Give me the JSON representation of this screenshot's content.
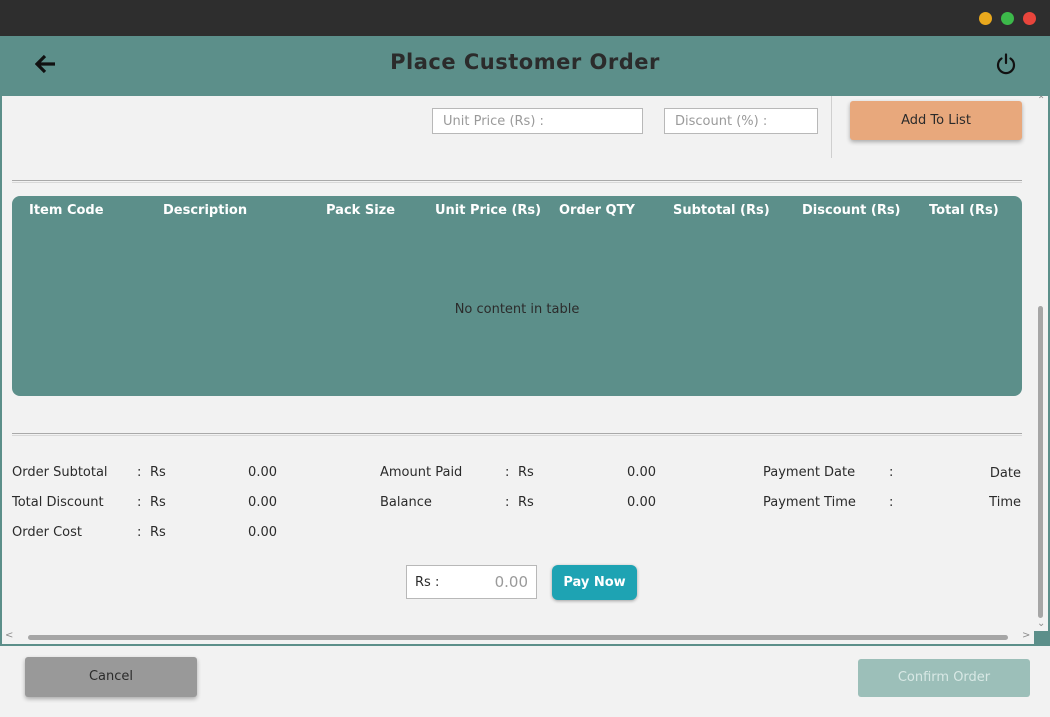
{
  "window": {
    "title": "Place Customer Order",
    "accent_color": "#5c8f8a"
  },
  "header": {
    "back_icon": "arrow-left-icon",
    "title": "Place Customer Order",
    "power_icon": "power-icon"
  },
  "form": {
    "unit_price_placeholder": "Unit Price (Rs) :",
    "discount_placeholder": "Discount (%) :",
    "add_button_label": "Add To List"
  },
  "table": {
    "columns": [
      "Item Code",
      "Description",
      "Pack Size",
      "Unit Price (Rs)",
      "Order QTY",
      "Subtotal (Rs)",
      "Discount (Rs)",
      "Total (Rs)"
    ],
    "empty_message": "No content in table",
    "rows": []
  },
  "summary": {
    "order_subtotal": {
      "label": "Order Subtotal",
      "sep": ":",
      "currency": "Rs",
      "value": "0.00"
    },
    "total_discount": {
      "label": "Total Discount",
      "sep": ":",
      "currency": "Rs",
      "value": "0.00"
    },
    "order_cost": {
      "label": "Order Cost",
      "sep": ":",
      "currency": "Rs",
      "value": "0.00"
    },
    "amount_paid": {
      "label": "Amount Paid",
      "sep": ":",
      "currency": "Rs",
      "value": "0.00"
    },
    "balance": {
      "label": "Balance",
      "sep": ":",
      "currency": "Rs",
      "value": "0.00"
    },
    "payment_date": {
      "label": "Payment Date",
      "sep": ":",
      "value": "Date"
    },
    "payment_time": {
      "label": "Payment Time",
      "sep": ":",
      "value": "Time"
    }
  },
  "payment": {
    "prefix": "Rs  :",
    "amount_placeholder": "0.00",
    "pay_button_label": "Pay Now",
    "pay_button_color": "#1ea3b3"
  },
  "footer": {
    "cancel_label": "Cancel",
    "confirm_label": "Confirm Order"
  }
}
